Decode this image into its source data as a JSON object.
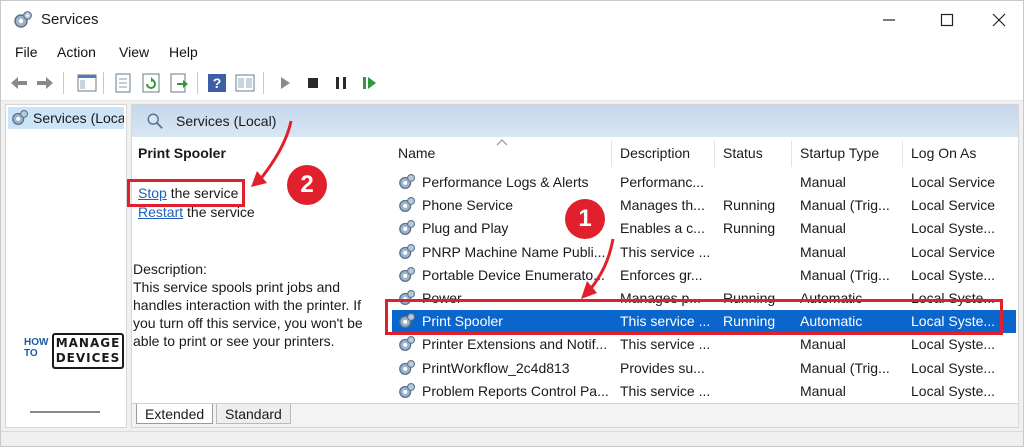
{
  "window": {
    "title": "Services"
  },
  "menu": [
    "File",
    "Action",
    "View",
    "Help"
  ],
  "tree": {
    "item": "Services (Local)"
  },
  "pane": {
    "header": "Services (Local)"
  },
  "details": {
    "title": "Print Spooler",
    "stop_link": "Stop",
    "stop_rest": " the service",
    "restart_link": "Restart",
    "restart_rest": " the service",
    "description_label": "Description:",
    "description_text": "This service spools print jobs and handles interaction with the printer. If you turn off this service, you won't be able to print or see your printers."
  },
  "columns": [
    "Name",
    "Description",
    "Status",
    "Startup Type",
    "Log On As"
  ],
  "rows": [
    {
      "name": "Performance Logs & Alerts",
      "description": "Performanc...",
      "status": "",
      "startup": "Manual",
      "logon": "Local Service"
    },
    {
      "name": "Phone Service",
      "description": "Manages th...",
      "status": "Running",
      "startup": "Manual (Trig...",
      "logon": "Local Service"
    },
    {
      "name": "Plug and Play",
      "description": "Enables a c...",
      "status": "Running",
      "startup": "Manual",
      "logon": "Local Syste..."
    },
    {
      "name": "PNRP Machine Name Publi...",
      "description": "This service ...",
      "status": "",
      "startup": "Manual",
      "logon": "Local Service"
    },
    {
      "name": "Portable Device Enumerato...",
      "description": "Enforces gr...",
      "status": "",
      "startup": "Manual (Trig...",
      "logon": "Local Syste..."
    },
    {
      "name": "Power",
      "description": "Manages p...",
      "status": "Running",
      "startup": "Automatic",
      "logon": "Local Syste..."
    },
    {
      "name": "Print Spooler",
      "description": "This service ...",
      "status": "Running",
      "startup": "Automatic",
      "logon": "Local Syste..."
    },
    {
      "name": "Printer Extensions and Notif...",
      "description": "This service ...",
      "status": "",
      "startup": "Manual",
      "logon": "Local Syste..."
    },
    {
      "name": "PrintWorkflow_2c4d813",
      "description": "Provides su...",
      "status": "",
      "startup": "Manual (Trig...",
      "logon": "Local Syste..."
    },
    {
      "name": "Problem Reports Control Pa...",
      "description": "This service ...",
      "status": "",
      "startup": "Manual",
      "logon": "Local Syste..."
    }
  ],
  "selected_row": 6,
  "tabs": [
    "Extended",
    "Standard"
  ],
  "annotations": {
    "badge1": "1",
    "badge2": "2"
  },
  "logo": {
    "how": "HOW",
    "to": "TO",
    "line1": "MANAGE",
    "line2": "DEVICES"
  },
  "colors": {
    "accent_red": "#e0212d",
    "selection_blue": "#0a66cc",
    "link_blue": "#1c5fbf"
  },
  "toolbar_icons": [
    "back-arrow-icon",
    "forward-arrow-icon",
    "console-tree-icon",
    "properties-icon",
    "refresh-icon",
    "export-icon",
    "help-icon",
    "view-icon",
    "play-icon",
    "stop-icon",
    "pause-icon",
    "resume-icon"
  ]
}
